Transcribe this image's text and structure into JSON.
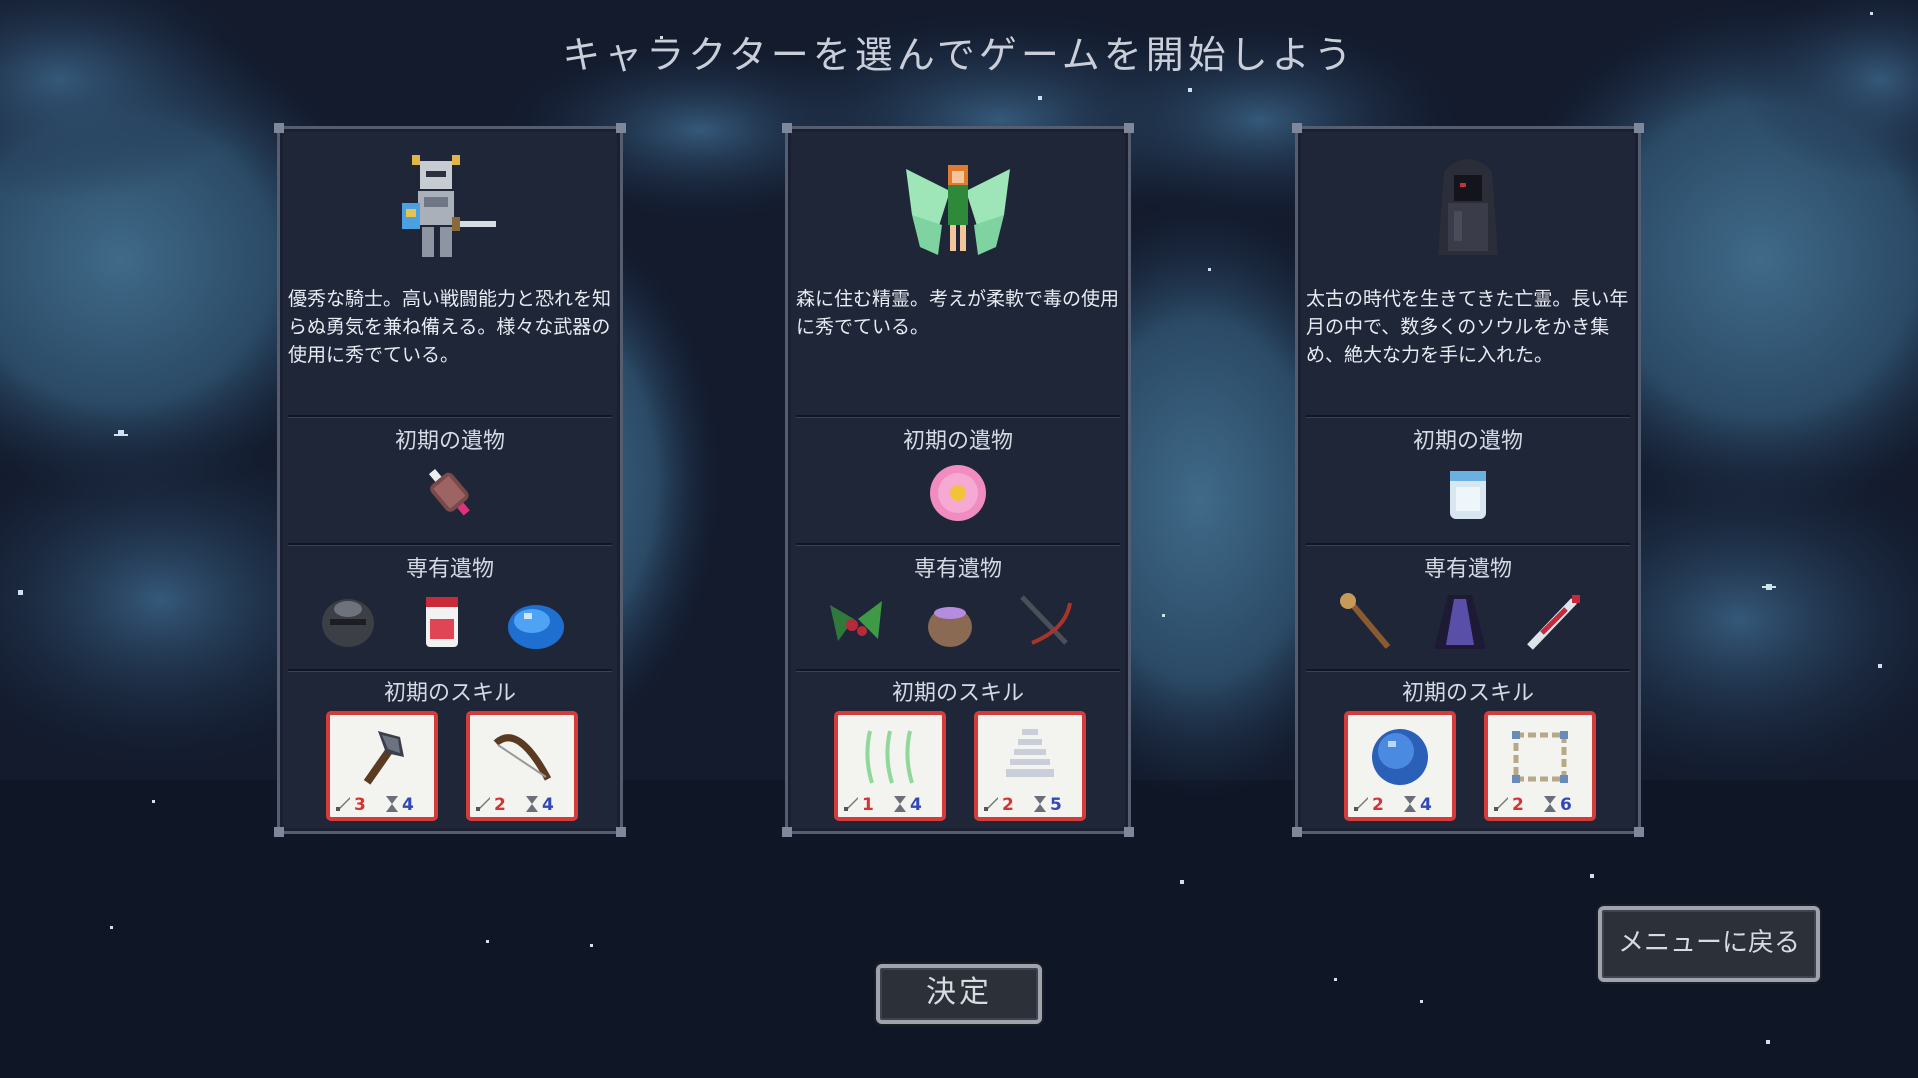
{
  "header": {
    "title": "キャラクターを選んでゲームを開始しよう"
  },
  "characters": [
    {
      "id": "knight",
      "description": "優秀な騎士。高い戦闘能力と恐れを知らぬ勇気を兼ね備える。様々な武器の使用に秀でている。",
      "starting_relic_label": "初期の遺物",
      "starting_relic_icon": "meat-relic-icon",
      "exclusive_relics_label": "専有遺物",
      "exclusive_relics": [
        "iron-helmet-icon",
        "potion-jar-icon",
        "blue-slime-icon"
      ],
      "starting_skills_label": "初期のスキル",
      "skills": [
        {
          "icon": "axe-icon",
          "damage": "3",
          "cooldown": "4"
        },
        {
          "icon": "bow-icon",
          "damage": "2",
          "cooldown": "4"
        }
      ]
    },
    {
      "id": "fairy",
      "description": "森に住む精霊。考えが柔軟で毒の使用に秀でている。",
      "starting_relic_label": "初期の遺物",
      "starting_relic_icon": "pink-flower-icon",
      "exclusive_relics_label": "専有遺物",
      "exclusive_relics": [
        "berry-branch-icon",
        "poison-pot-icon",
        "crossbow-icon"
      ],
      "starting_skills_label": "初期のスキル",
      "skills": [
        {
          "icon": "vine-chains-icon",
          "damage": "1",
          "cooldown": "4"
        },
        {
          "icon": "tornado-icon",
          "damage": "2",
          "cooldown": "5"
        }
      ]
    },
    {
      "id": "ghost",
      "description": "太古の時代を生きてきた亡霊。長い年月の中で、数多くのソウルをかき集め、絶大な力を手に入れた。",
      "starting_relic_label": "初期の遺物",
      "starting_relic_icon": "soul-jar-icon",
      "exclusive_relics_label": "専有遺物",
      "exclusive_relics": [
        "bone-staff-icon",
        "dark-cloak-icon",
        "bloody-sword-icon"
      ],
      "starting_skills_label": "初期のスキル",
      "skills": [
        {
          "icon": "blue-orb-icon",
          "damage": "2",
          "cooldown": "4"
        },
        {
          "icon": "rune-frame-icon",
          "damage": "2",
          "cooldown": "6"
        }
      ]
    }
  ],
  "buttons": {
    "confirm": "決定",
    "back_to_menu": "メニューに戻る"
  },
  "colors": {
    "card_bg": "#1f2638",
    "skill_border": "#d43c3c",
    "damage": "#d43434",
    "cooldown": "#3348b8"
  }
}
